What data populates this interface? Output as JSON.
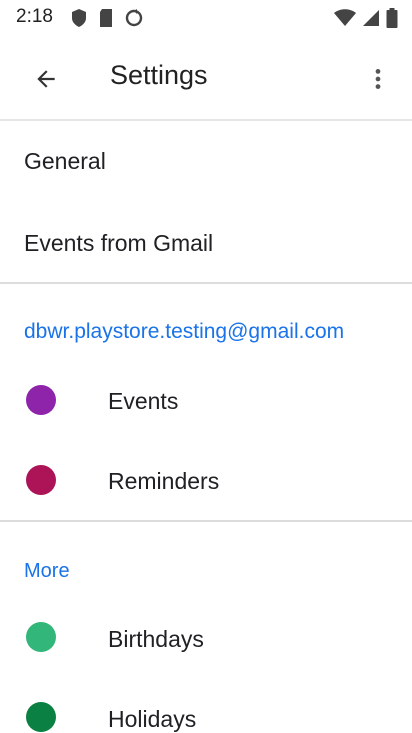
{
  "status_bar": {
    "time": "2:18",
    "icons_left": [
      "shield-icon",
      "sd-card-icon",
      "sync-icon"
    ],
    "icons_right": [
      "wifi-icon",
      "signal-icon",
      "battery-icon"
    ]
  },
  "app_bar": {
    "title": "Settings",
    "back_icon": "arrow-back-icon",
    "menu_icon": "more-vert-icon"
  },
  "settings": {
    "general_label": "General",
    "events_from_gmail_label": "Events from Gmail"
  },
  "account": {
    "email": "dbwr.playstore.testing@gmail.com",
    "calendars": [
      {
        "label": "Events",
        "color": "#8e24aa"
      },
      {
        "label": "Reminders",
        "color": "#ad1457"
      }
    ]
  },
  "more": {
    "section_label": "More",
    "calendars": [
      {
        "label": "Birthdays",
        "color": "#33b679"
      },
      {
        "label": "Holidays",
        "color": "#0b8043"
      }
    ]
  },
  "colors": {
    "accent": "#1a73e8",
    "divider": "#dcdcdc"
  }
}
